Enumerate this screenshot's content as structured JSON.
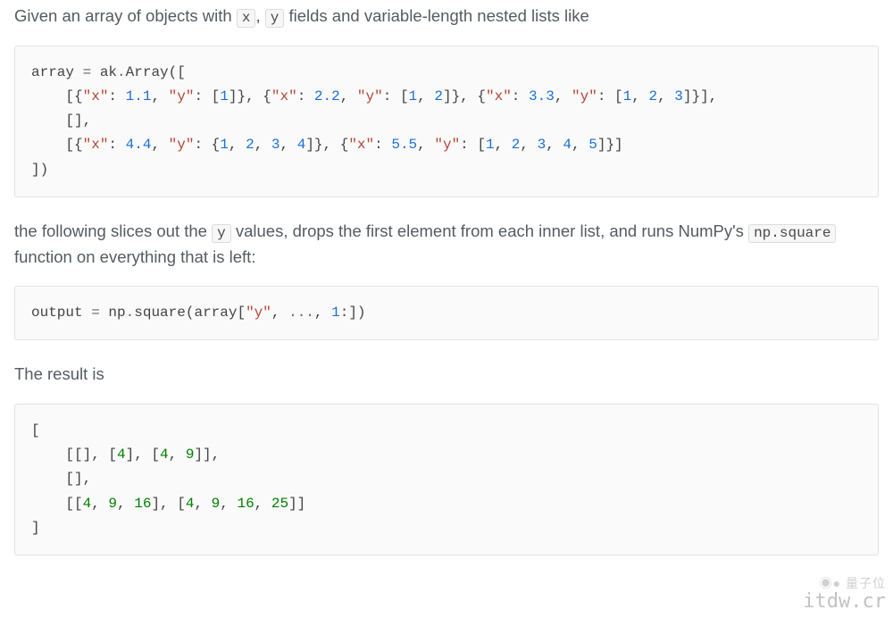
{
  "para1": {
    "t1": "Given an array of objects with ",
    "code_x": "x",
    "t2": ", ",
    "code_y": "y",
    "t3": " fields and variable-length nested lists like"
  },
  "code1": {
    "l1_a": "array ",
    "l1_b": "=",
    "l1_c": " ak",
    "l1_d": ".",
    "l1_e": "Array([",
    "l2_a": "    [{",
    "l2_b": "\"x\"",
    "l2_c": ": ",
    "l2_d": "1.1",
    "l2_e": ", ",
    "l2_f": "\"y\"",
    "l2_g": ": [",
    "l2_h": "1",
    "l2_i": "]}, {",
    "l2_j": "\"x\"",
    "l2_k": ": ",
    "l2_l": "2.2",
    "l2_m": ", ",
    "l2_n": "\"y\"",
    "l2_o": ": [",
    "l2_p": "1",
    "l2_q": ", ",
    "l2_r": "2",
    "l2_s": "]}, {",
    "l2_t": "\"x\"",
    "l2_u": ": ",
    "l2_v": "3.3",
    "l2_w": ", ",
    "l2_x": "\"y\"",
    "l2_y": ": [",
    "l2_z": "1",
    "l2_aa": ", ",
    "l2_ab": "2",
    "l2_ac": ", ",
    "l2_ad": "3",
    "l2_ae": "]}],",
    "l3": "    [],",
    "l4_a": "    [{",
    "l4_b": "\"x\"",
    "l4_c": ": ",
    "l4_d": "4.4",
    "l4_e": ", ",
    "l4_f": "\"y\"",
    "l4_g": ": {",
    "l4_h": "1",
    "l4_i": ", ",
    "l4_j": "2",
    "l4_k": ", ",
    "l4_l": "3",
    "l4_m": ", ",
    "l4_n": "4",
    "l4_o": "]}, {",
    "l4_p": "\"x\"",
    "l4_q": ": ",
    "l4_r": "5.5",
    "l4_s": ", ",
    "l4_t": "\"y\"",
    "l4_u": ": [",
    "l4_v": "1",
    "l4_w": ", ",
    "l4_x": "2",
    "l4_y": ", ",
    "l4_z": "3",
    "l4_aa": ", ",
    "l4_ab": "4",
    "l4_ac": ", ",
    "l4_ad": "5",
    "l4_ae": "]}]",
    "l5": "])"
  },
  "para2": {
    "t1": "the following slices out the ",
    "code_y": "y",
    "t2": " values, drops the first element from each inner list, and runs NumPy's ",
    "code_np": "np.square",
    "t3": " function on everything that is left:"
  },
  "code2": {
    "a": "output ",
    "b": "=",
    "c": " np",
    "d": ".",
    "e": "square(array[",
    "f": "\"y\"",
    "g": ", ",
    "h": "...",
    "i": ", ",
    "j": "1",
    "k": ":])"
  },
  "para3": "The result is",
  "code3": {
    "l1": "[",
    "l2_a": "    [[], [",
    "l2_b": "4",
    "l2_c": "], [",
    "l2_d": "4",
    "l2_e": ", ",
    "l2_f": "9",
    "l2_g": "]],",
    "l3": "    [],",
    "l4_a": "    [[",
    "l4_b": "4",
    "l4_c": ", ",
    "l4_d": "9",
    "l4_e": ", ",
    "l4_f": "16",
    "l4_g": "], [",
    "l4_h": "4",
    "l4_i": ", ",
    "l4_j": "9",
    "l4_k": ", ",
    "l4_l": "16",
    "l4_m": ", ",
    "l4_n": "25",
    "l4_o": "]]",
    "l5": "]"
  },
  "watermark": {
    "line1": "◉● 量子位",
    "line2": "itdw.cr"
  }
}
